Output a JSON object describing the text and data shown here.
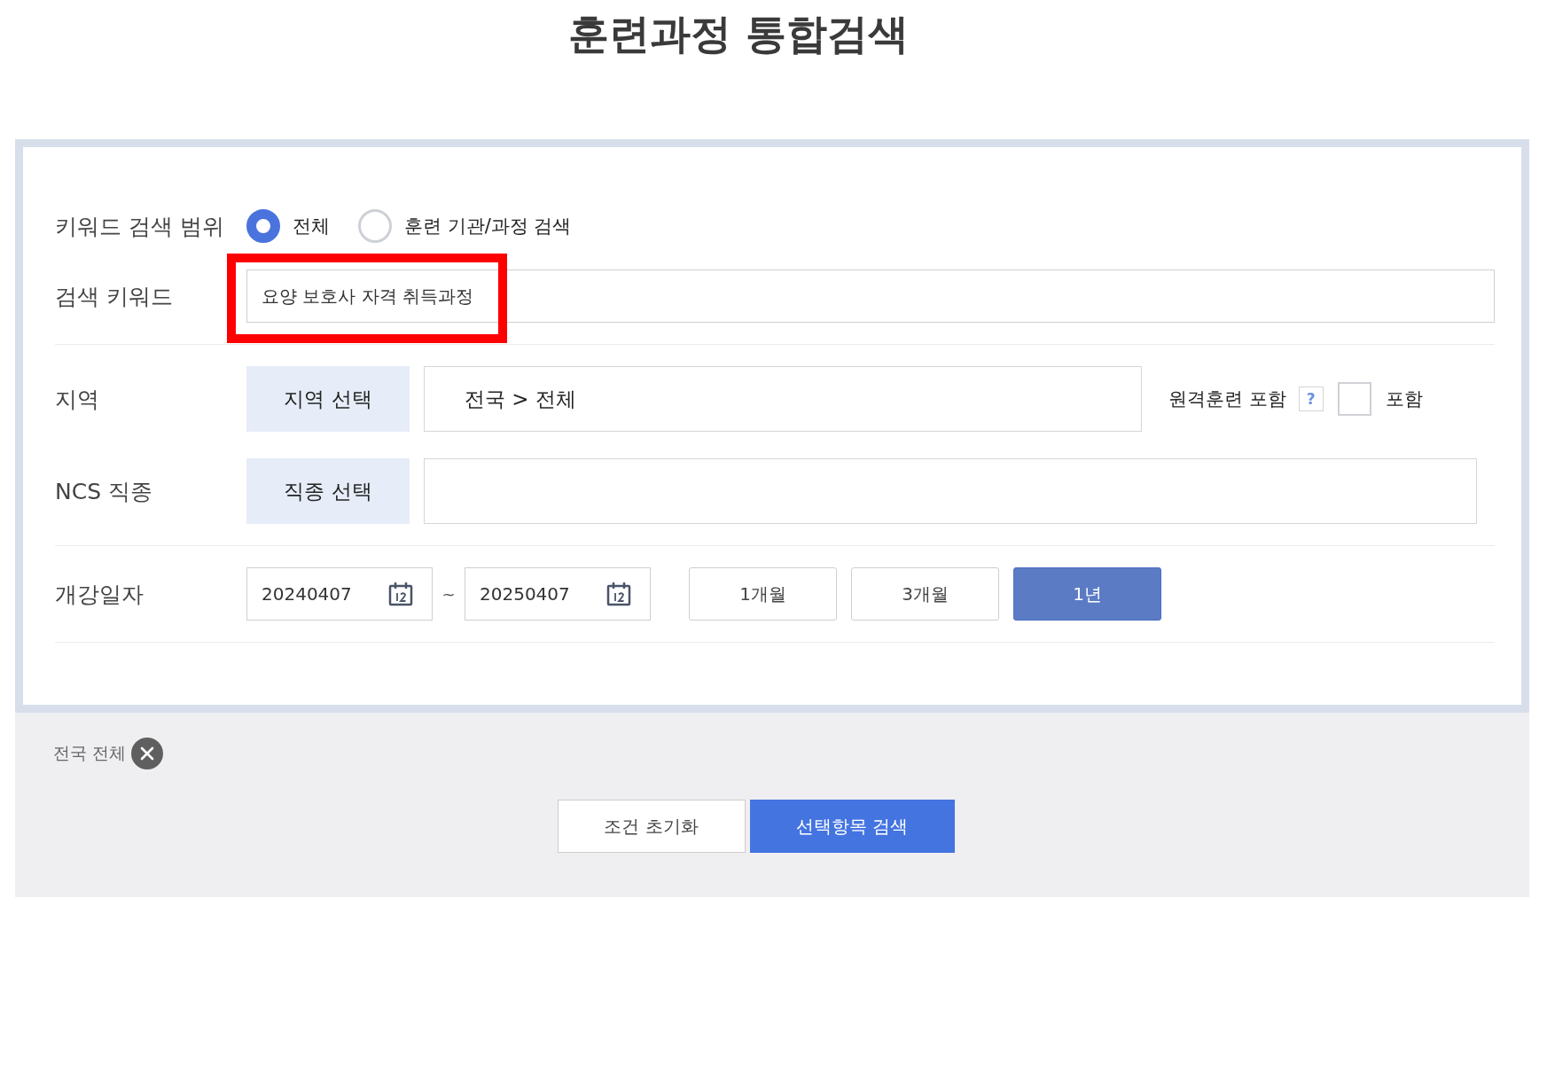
{
  "title": "훈련과정 통합검색",
  "keyword_scope": {
    "label": "키워드 검색 범위",
    "options": [
      {
        "label": "전체",
        "selected": true
      },
      {
        "label": "훈련 기관/과정 검색",
        "selected": false
      }
    ]
  },
  "keyword": {
    "label": "검색 키워드",
    "value": "요양 보호사 자격 취득과정",
    "highlighted": true
  },
  "region": {
    "label": "지역",
    "button": "지역 선택",
    "value": "전국 > 전체",
    "remote": {
      "label": "원격훈련 포함",
      "help": "?",
      "checked": false,
      "option": "포함"
    }
  },
  "ncs": {
    "label": "NCS 직종",
    "button": "직종 선택"
  },
  "open_date": {
    "label": "개강일자",
    "from": "20240407",
    "separator": "~",
    "to": "20250407",
    "periods": [
      {
        "label": "1개월",
        "selected": false
      },
      {
        "label": "3개월",
        "selected": false
      },
      {
        "label": "1년",
        "selected": true
      }
    ]
  },
  "filters": [
    {
      "label": "전국 전체"
    }
  ],
  "buttons": [
    {
      "label": "조건 초기화",
      "kind": "reset"
    },
    {
      "label": "선택항목 검색",
      "kind": "search"
    }
  ]
}
